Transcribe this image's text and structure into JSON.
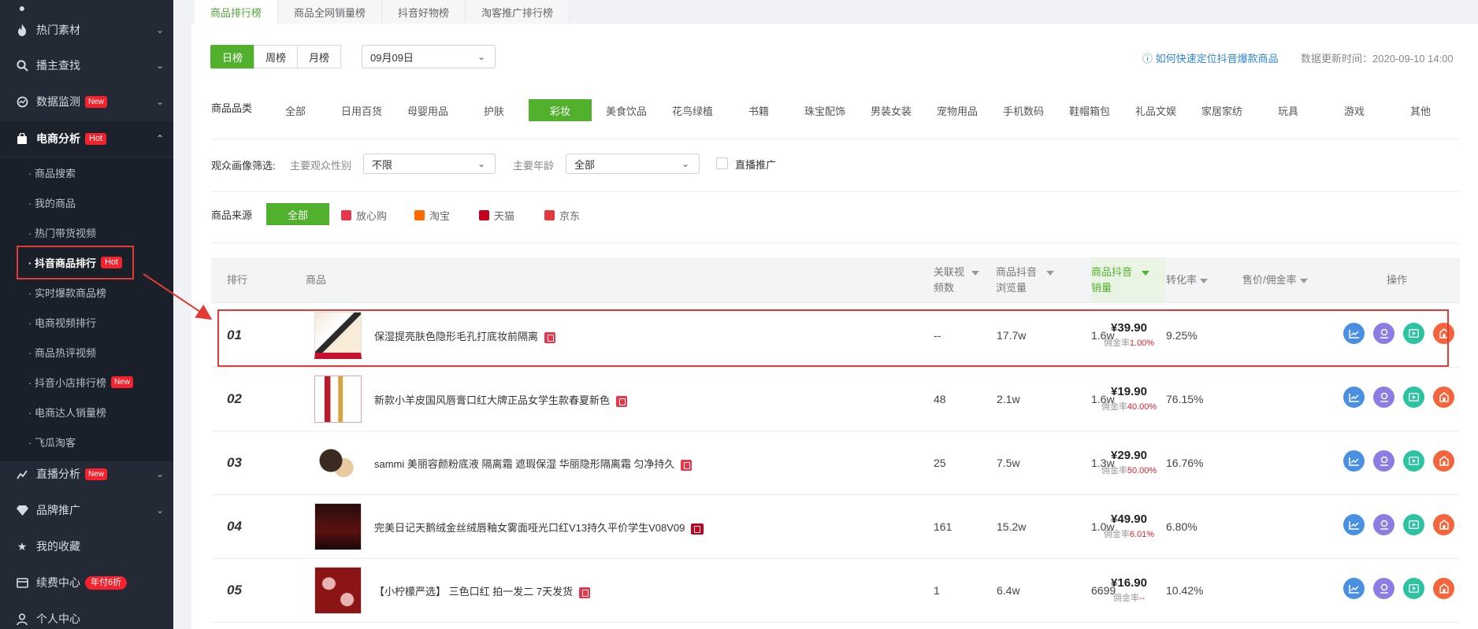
{
  "sidebar": {
    "items": [
      {
        "label": "热门素材"
      },
      {
        "label": "播主查找"
      },
      {
        "label": "数据监测",
        "badge": "New"
      },
      {
        "label": "电商分析",
        "badge": "Hot"
      },
      {
        "label": "直播分析",
        "badge": "New"
      },
      {
        "label": "品牌推广"
      },
      {
        "label": "我的收藏"
      },
      {
        "label": "续费中心",
        "badge": "年付6折"
      },
      {
        "label": "个人中心"
      }
    ],
    "sub_items": [
      {
        "label": "· 商品搜索"
      },
      {
        "label": "· 我的商品"
      },
      {
        "label": "· 热门带货视频"
      },
      {
        "label": "· 抖音商品排行",
        "badge": "Hot"
      },
      {
        "label": "· 实时爆款商品榜"
      },
      {
        "label": "· 电商视频排行"
      },
      {
        "label": "· 商品热评视频"
      },
      {
        "label": "· 抖音小店排行榜",
        "badge": "New"
      },
      {
        "label": "· 电商达人销量榜"
      },
      {
        "label": "· 飞瓜淘客"
      }
    ]
  },
  "tabs": [
    "商品排行榜",
    "商品全网销量榜",
    "抖音好物榜",
    "淘客推广排行榜"
  ],
  "period": {
    "options": [
      "日榜",
      "周榜",
      "月榜"
    ],
    "selected": "日榜",
    "date": "09月09日"
  },
  "help_link": "如何快速定位抖音爆款商品",
  "update_time": "数据更新时间：2020-09-10 14:00",
  "category": {
    "label": "商品品类",
    "options": [
      "全部",
      "日用百货",
      "母婴用品",
      "护肤",
      "彩妆",
      "美食饮品",
      "花鸟绿植",
      "书籍",
      "珠宝配饰",
      "男装女装",
      "宠物用品",
      "手机数码",
      "鞋帽箱包",
      "礼品文娱",
      "家居家纺",
      "玩具",
      "游戏",
      "其他"
    ],
    "selected": "彩妆"
  },
  "audience": {
    "label": "观众画像筛选:",
    "gender_label": "主要观众性别",
    "gender_value": "不限",
    "age_label": "主要年龄",
    "age_value": "全部",
    "live_label": "直播推广"
  },
  "source": {
    "label": "商品来源",
    "all": "全部",
    "options": [
      {
        "label": "放心购",
        "color": "#e9364a"
      },
      {
        "label": "淘宝",
        "color": "#ff6a00"
      },
      {
        "label": "天猫",
        "color": "#c4001c"
      },
      {
        "label": "京东",
        "color": "#e4393c"
      }
    ]
  },
  "table": {
    "headers": {
      "rank": "排行",
      "product": "商品",
      "videos": [
        "关联视",
        "频数"
      ],
      "views": [
        "商品抖音",
        "浏览量"
      ],
      "sales": [
        "商品抖音",
        "销量"
      ],
      "conversion": "转化率",
      "price": "售价/佣金率",
      "ops": "操作"
    },
    "commission_prefix": "佣金率",
    "rows": [
      {
        "rank": "01",
        "name": "保湿提亮肤色隐形毛孔打底妆前隔离",
        "shop": "fxg",
        "videos": "--",
        "views": "17.7w",
        "sales": "1.6w",
        "conversion": "9.25%",
        "price": "¥39.90",
        "commission": "1.00%"
      },
      {
        "rank": "02",
        "name": "新款小羊皮国风唇膏口红大牌正品女学生款春夏新色",
        "shop": "fxg",
        "videos": "48",
        "views": "2.1w",
        "sales": "1.6w",
        "conversion": "76.15%",
        "price": "¥19.90",
        "commission": "40.00%"
      },
      {
        "rank": "03",
        "name": "sammi 美丽容颜粉底液 隔离霜 遮瑕保湿 华丽隐形隔离霜 匀净持久",
        "shop": "fxg",
        "videos": "25",
        "views": "7.5w",
        "sales": "1.3w",
        "conversion": "16.76%",
        "price": "¥29.90",
        "commission": "50.00%"
      },
      {
        "rank": "04",
        "name": "完美日记天鹅绒金丝绒唇釉女雾面哑光口红V13持久平价学生V08V09",
        "shop": "tmall",
        "videos": "161",
        "views": "15.2w",
        "sales": "1.0w",
        "conversion": "6.80%",
        "price": "¥49.90",
        "commission": "6.01%"
      },
      {
        "rank": "05",
        "name": "【小柠檬严选】 三色口红 拍一发二 7天发货",
        "shop": "fxg",
        "videos": "1",
        "views": "6.4w",
        "sales": "6699",
        "conversion": "10.42%",
        "price": "¥16.90",
        "commission": "--"
      }
    ]
  },
  "colors": {
    "accent": "#52b12c",
    "sidebar": "#232a36",
    "highlight": "#e53935",
    "link": "#2f86d6"
  }
}
